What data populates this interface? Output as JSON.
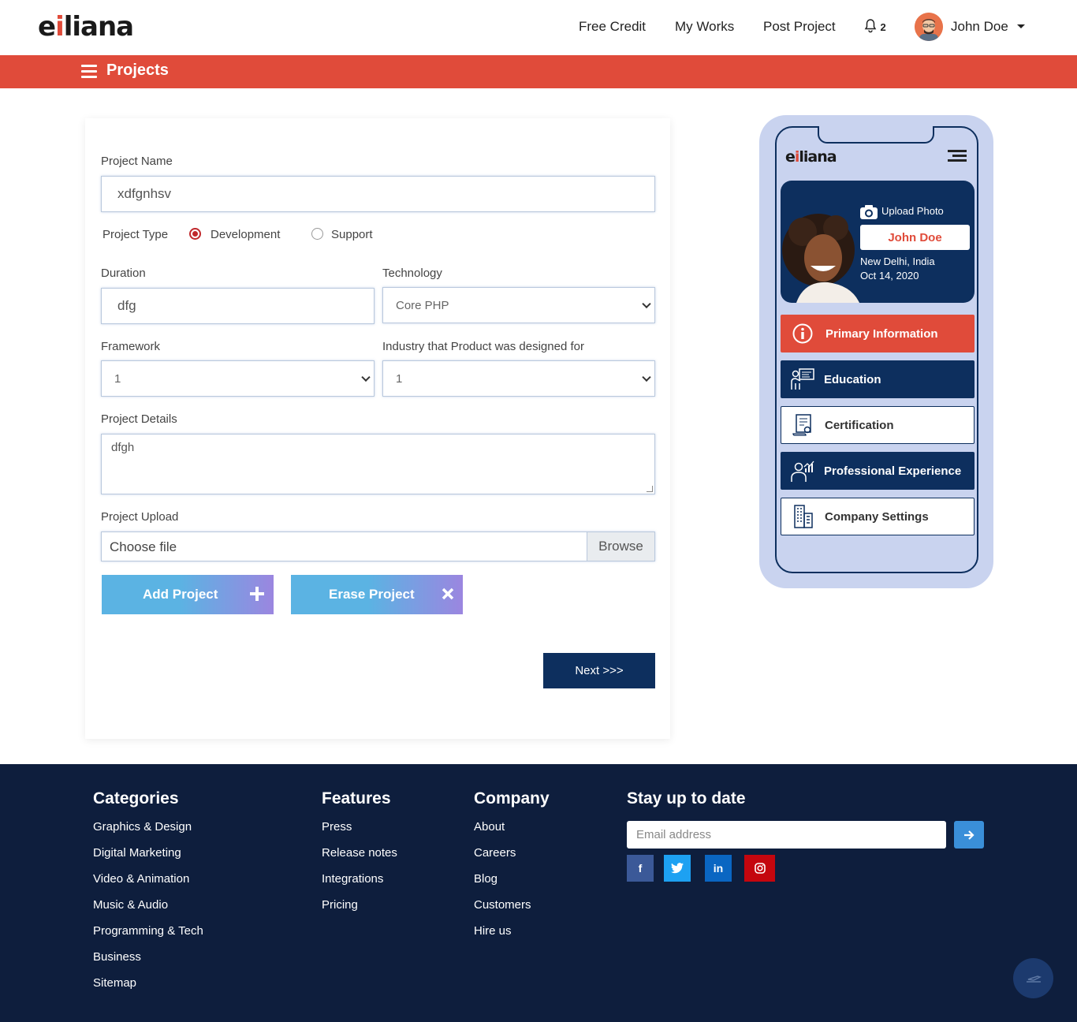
{
  "header": {
    "logo_prefix": "e",
    "logo_dot": "i",
    "logo_suffix": "liana",
    "nav": [
      "Free Credit",
      "My Works",
      "Post Project"
    ],
    "notification_count": "2",
    "user_name": "John Doe"
  },
  "page_bar": {
    "title": "Projects"
  },
  "form": {
    "project_name_label": "Project Name",
    "project_name_value": "xdfgnhsv",
    "project_type_label": "Project Type",
    "project_type_options": [
      "Development",
      "Support"
    ],
    "project_type_selected": "Development",
    "duration_label": "Duration",
    "duration_value": "dfg",
    "technology_label": "Technology",
    "technology_value": "Core PHP",
    "framework_label": "Framework",
    "framework_value": "1",
    "industry_label": "Industry that Product was designed for",
    "industry_value": "1",
    "details_label": "Project Details",
    "details_value": "dfgh",
    "upload_label": "Project Upload",
    "upload_placeholder": "Choose file",
    "browse_label": "Browse",
    "add_label": "Add Project",
    "erase_label": "Erase Project",
    "next_label": "Next >>>"
  },
  "phone": {
    "upload_photo": "Upload Photo",
    "name": "John Doe",
    "location": "New Delhi, India",
    "date": "Oct 14, 2020",
    "menu": [
      {
        "label": "Primary Information",
        "style": "active"
      },
      {
        "label": "Education",
        "style": "dark"
      },
      {
        "label": "Certification",
        "style": "light"
      },
      {
        "label": "Professional Experience",
        "style": "dark"
      },
      {
        "label": "Company Settings",
        "style": "light"
      }
    ]
  },
  "footer": {
    "categories": {
      "title": "Categories",
      "links": [
        "Graphics & Design",
        "Digital Marketing",
        "Video & Animation",
        "Music & Audio",
        "Programming & Tech",
        "Business",
        "Sitemap"
      ]
    },
    "features": {
      "title": "Features",
      "links": [
        "Press",
        "Release notes",
        "Integrations",
        "Pricing"
      ]
    },
    "company": {
      "title": "Company",
      "links": [
        "About",
        "Careers",
        "Blog",
        "Customers",
        "Hire us"
      ]
    },
    "newsletter": {
      "title": "Stay up to date",
      "placeholder": "Email address"
    },
    "social": [
      {
        "icon": "facebook-icon",
        "glyph": "f",
        "color": "#3b5998"
      },
      {
        "icon": "twitter-icon",
        "glyph": "t",
        "color": "#1da1f2"
      },
      {
        "icon": "linkedin-icon",
        "glyph": "in",
        "color": "#0a66c2"
      },
      {
        "icon": "instagram-icon",
        "glyph": "◎",
        "color": "#c4060e"
      }
    ]
  },
  "colors": {
    "brand_red": "#e04b3a",
    "navy": "#0d2f5e",
    "footer_bg": "#0e1e3d",
    "phone_bg": "#c9d3ef"
  }
}
